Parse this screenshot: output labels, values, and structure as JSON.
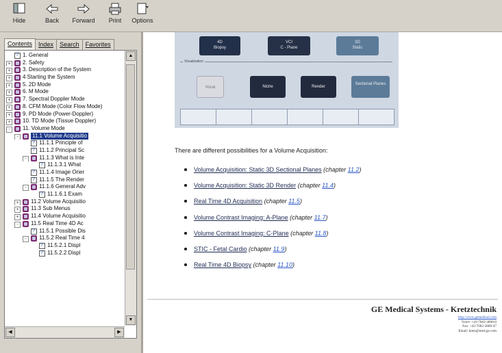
{
  "toolbar": {
    "hide": "Hide",
    "back": "Back",
    "forward": "Forward",
    "print": "Print",
    "options": "Options"
  },
  "tabs": [
    {
      "label": "Contents"
    },
    {
      "label": "Index"
    },
    {
      "label": "Search"
    },
    {
      "label": "Favorites"
    }
  ],
  "tree": [
    {
      "label": "1. General",
      "indent": 0,
      "icon": "page",
      "exp": ""
    },
    {
      "label": "2. Safety",
      "indent": 0,
      "icon": "book",
      "exp": "+"
    },
    {
      "label": "3. Description of the System",
      "indent": 0,
      "icon": "book",
      "exp": "+"
    },
    {
      "label": "4 Starting the System",
      "indent": 0,
      "icon": "book",
      "exp": "+"
    },
    {
      "label": "5. 2D Mode",
      "indent": 0,
      "icon": "book",
      "exp": "+"
    },
    {
      "label": "6. M Mode",
      "indent": 0,
      "icon": "book",
      "exp": "+"
    },
    {
      "label": "7. Spectral Doppler Mode",
      "indent": 0,
      "icon": "book",
      "exp": "+"
    },
    {
      "label": "8. CFM Mode (Color Flow Mode)",
      "indent": 0,
      "icon": "book",
      "exp": "+"
    },
    {
      "label": "9. PD Mode (Power-Doppler)",
      "indent": 0,
      "icon": "book",
      "exp": "+"
    },
    {
      "label": "10. TD Mode (Tissue Doppler)",
      "indent": 0,
      "icon": "book",
      "exp": "+"
    },
    {
      "label": "11. Volume Mode",
      "indent": 0,
      "icon": "book",
      "exp": "-"
    },
    {
      "label": "11.1 Volume Acquisitio",
      "indent": 1,
      "icon": "book",
      "exp": "-",
      "selected": true
    },
    {
      "label": "11.1.1 Principle of",
      "indent": 2,
      "icon": "page",
      "exp": ""
    },
    {
      "label": "11.1.2 Principal Sc",
      "indent": 2,
      "icon": "page",
      "exp": ""
    },
    {
      "label": "11.1.3 What is Inte",
      "indent": 2,
      "icon": "book",
      "exp": "-"
    },
    {
      "label": "11.1.3.1 What",
      "indent": 3,
      "icon": "page",
      "exp": ""
    },
    {
      "label": "11.1.4 Image Orier",
      "indent": 2,
      "icon": "page",
      "exp": ""
    },
    {
      "label": "11.1.5 The Render",
      "indent": 2,
      "icon": "page",
      "exp": ""
    },
    {
      "label": "11.1.6 General Adv",
      "indent": 2,
      "icon": "book",
      "exp": "-"
    },
    {
      "label": "11.1.6.1 Exam",
      "indent": 3,
      "icon": "page",
      "exp": ""
    },
    {
      "label": "11.2 Volume Acquisitio",
      "indent": 1,
      "icon": "book",
      "exp": "+"
    },
    {
      "label": "11.3 Sub Menus",
      "indent": 1,
      "icon": "book",
      "exp": "+"
    },
    {
      "label": "11.4 Volume Acquisitio",
      "indent": 1,
      "icon": "book",
      "exp": "+"
    },
    {
      "label": "11.5 Real Time 4D Ac",
      "indent": 1,
      "icon": "book",
      "exp": "-"
    },
    {
      "label": "11.5.1 Possible Dis",
      "indent": 2,
      "icon": "page",
      "exp": ""
    },
    {
      "label": "11.5.2 Real Time 4",
      "indent": 2,
      "icon": "book",
      "exp": "-"
    },
    {
      "label": "11.5.2.1 Displ",
      "indent": 3,
      "icon": "page",
      "exp": ""
    },
    {
      "label": "11.5.2.2 Displ",
      "indent": 3,
      "icon": "page",
      "exp": ""
    }
  ],
  "screenshot": {
    "top_buttons": [
      {
        "l1": "4D",
        "l2": "Biopsy"
      },
      {
        "l1": "VCI",
        "l2": "C - Plane"
      },
      {
        "l1": "3D",
        "l2": "Static"
      }
    ],
    "visualization_label": "Visualization",
    "vis_buttons": [
      {
        "label": "Vocal"
      },
      {
        "label": "Niche"
      },
      {
        "label": "Render"
      },
      {
        "label": "Sectional Planes"
      }
    ]
  },
  "content": {
    "intro": "There are different possibilities for a Volume Acquisition:",
    "items": [
      {
        "link": "Volume Acquisition: Static 3D Sectional Planes",
        "chapter_prefix": "(chapter ",
        "chapter_num": "11.2",
        "chapter_suffix": ")"
      },
      {
        "link": "Volume Acquisition: Static 3D Render",
        "chapter_prefix": "(chapter ",
        "chapter_num": "11.4",
        "chapter_suffix": ")"
      },
      {
        "link": "Real Time 4D Acquisition",
        "chapter_prefix": "(chapter ",
        "chapter_num": "11.5",
        "chapter_suffix": ")"
      },
      {
        "link": "Volume Contrast Imaging: A-Plane",
        "chapter_prefix": "(chapter ",
        "chapter_num": "11.7",
        "chapter_suffix": ")"
      },
      {
        "link": "Volume Contrast Imaging: C-Plane",
        "chapter_prefix": "(chapter ",
        "chapter_num": "11.8",
        "chapter_suffix": ")"
      },
      {
        "link": "STIC - Fetal Cardio",
        "chapter_prefix": "(chapter ",
        "chapter_num": "11.9",
        "chapter_suffix": ")"
      },
      {
        "link": "Real Time 4D Biopsy",
        "chapter_prefix": "(chapter ",
        "chapter_num": "11.10",
        "chapter_suffix": ")"
      }
    ]
  },
  "footer": {
    "company": "GE Medical Systems - Kretztechnik",
    "url": "http://www.gemedical.com",
    "voice": "Voice: +43-7682-3800-0",
    "fax": "Fax: +43-7682-3800-47",
    "email": "Email: kretz@med.ge.com"
  }
}
